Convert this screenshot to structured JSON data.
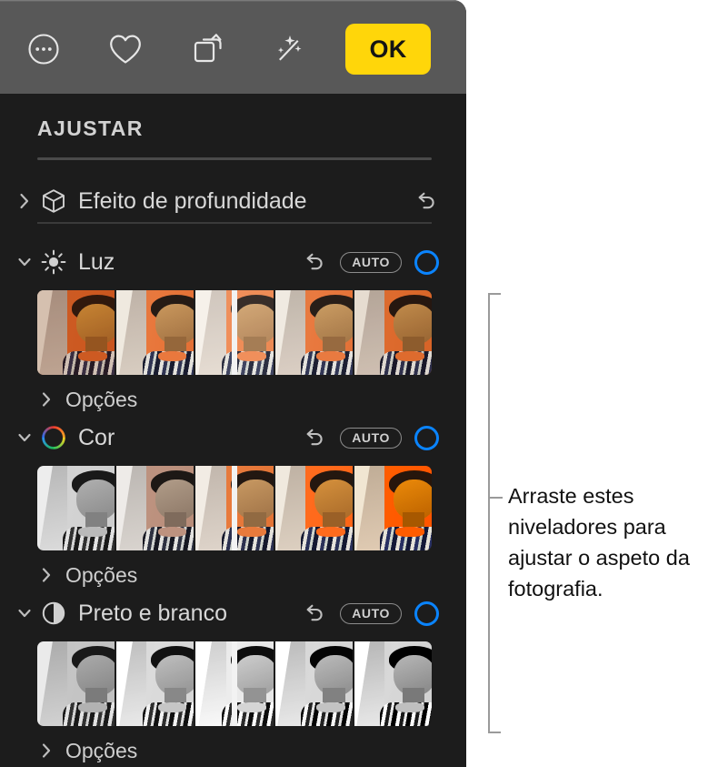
{
  "toolbar": {
    "buttons": [
      {
        "name": "more-options",
        "icon": "ellipsis-circle-icon",
        "label": ""
      },
      {
        "name": "favorite",
        "icon": "heart-icon",
        "label": ""
      },
      {
        "name": "rotate",
        "icon": "rotate-icon",
        "label": ""
      },
      {
        "name": "enhance",
        "icon": "magic-wand-icon",
        "label": ""
      }
    ],
    "ok_label": "OK",
    "ok_color": "#FFD60A",
    "background": "#585858"
  },
  "panel": {
    "background": "#1C1C1C",
    "title": "AJUSTAR",
    "accent_color": "#0A84FF",
    "groups": [
      {
        "id": "depth",
        "label": "Efeito de profundidade",
        "icon": "cube-icon",
        "expanded": false,
        "twisty": "chevron-right-icon",
        "reset_label": "↩",
        "has_auto": false,
        "has_level_ring": false,
        "has_filmstrip": false,
        "has_options": false
      },
      {
        "id": "luz",
        "label": "Luz",
        "icon": "sun-icon",
        "expanded": true,
        "twisty": "chevron-down-icon",
        "reset_label": "↩",
        "auto_label": "AUTO",
        "has_auto": true,
        "has_level_ring": true,
        "has_filmstrip": true,
        "filmstrip_style": "light",
        "frames": 5,
        "playhead_frame": 3,
        "has_options": true,
        "options_label": "Opções"
      },
      {
        "id": "cor",
        "label": "Cor",
        "icon": "color-wheel-icon",
        "expanded": true,
        "twisty": "chevron-down-icon",
        "reset_label": "↩",
        "auto_label": "AUTO",
        "has_auto": true,
        "has_level_ring": true,
        "has_filmstrip": true,
        "filmstrip_style": "saturation",
        "frames": 5,
        "playhead_frame": 3,
        "has_options": true,
        "options_label": "Opções"
      },
      {
        "id": "preto-e-branco",
        "label": "Preto e branco",
        "icon": "contrast-circle-icon",
        "expanded": true,
        "twisty": "chevron-down-icon",
        "reset_label": "↩",
        "auto_label": "AUTO",
        "has_auto": true,
        "has_level_ring": true,
        "has_filmstrip": true,
        "filmstrip_style": "mono",
        "frames": 5,
        "playhead_frame": 3,
        "has_options": true,
        "options_label": "Opções"
      }
    ]
  },
  "callout": {
    "text": "Arraste estes niveladores para ajustar o aspeto da fotografia.",
    "bracket_color": "#9A9A9A",
    "text_color": "#111111"
  }
}
